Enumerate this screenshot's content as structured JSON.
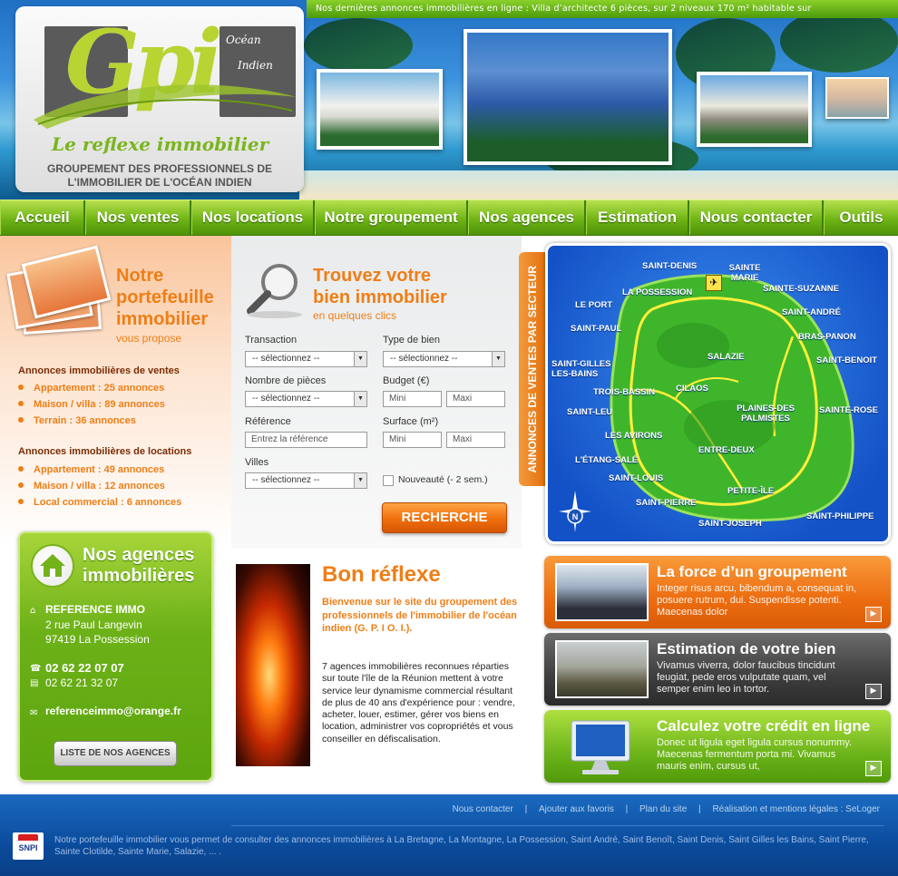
{
  "header": {
    "ticker": "Nos dernières annonces immobilières en ligne : Villa d’architecte 6 pièces, sur 2 niveaux 170 m² habitable sur",
    "logo_letters": "Gpi",
    "logo_ocean": "Océan",
    "logo_indien": "Indien",
    "logo_tagline": "Le reflexe immobilier",
    "logo_sub1": "GROUPEMENT DES PROFESSIONNELS DE",
    "logo_sub2": "L'IMMOBILIER DE L'OCÉAN INDIEN"
  },
  "nav": [
    {
      "label": "Accueil"
    },
    {
      "label": "Nos ventes"
    },
    {
      "label": "Nos locations"
    },
    {
      "label": "Notre groupement"
    },
    {
      "label": "Nos agences"
    },
    {
      "label": "Estimation"
    },
    {
      "label": "Nous contacter"
    },
    {
      "label": "Outils"
    }
  ],
  "portfolio": {
    "title": "Notre portefeuille immobilier",
    "subtitle": "vous propose",
    "sales_heading": "Annonces immobilières de ventes",
    "sales": [
      "Appartement : 25 annonces",
      "Maison / villa : 89 annonces",
      "Terrain : 36 annonces"
    ],
    "rentals_heading": "Annonces immobilières de locations",
    "rentals": [
      "Appartement : 49 annonces",
      "Maison / villa : 12 annonces",
      "Local commercial : 6 annonces"
    ]
  },
  "agencies": {
    "title": "Nos agences immobilières",
    "name": "REFERENCE IMMO",
    "address1": "2 rue Paul Langevin",
    "address2": "97419 La Possession",
    "phone": "02 62 22 07 07",
    "fax": "02 62 21 32 07",
    "email": "referenceimmo@orange.fr",
    "button": "LISTE DE NOS AGENCES"
  },
  "search": {
    "title": "Trouvez votre bien immobilier",
    "subtitle": "en quelques clics",
    "transaction_label": "Transaction",
    "type_label": "Type de bien",
    "rooms_label": "Nombre de pièces",
    "budget_label": "Budget (€)",
    "reference_label": "Référence",
    "surface_label": "Surface (m²)",
    "cities_label": "Villes",
    "select_placeholder": "-- sélectionnez --",
    "reference_placeholder": "Entrez la référence",
    "min_placeholder": "Mini",
    "max_placeholder": "Maxi",
    "new_label": "Nouveauté (- 2 sem.)",
    "button": "RECHERCHE"
  },
  "map": {
    "tab_label": "ANNONCES DE VENTES  PAR SECTEUR",
    "towns": [
      "SAINT-DENIS",
      "SAINTE MARIE",
      "SAINTE-SUZANNE",
      "LA POSSESSION",
      "LE PORT",
      "SAINT-ANDRÉ",
      "SAINT-PAUL",
      "BRAS-PANON",
      "SALAZIE",
      "SAINT-BENOIT",
      "SAINT-GILLES LES-BAINS",
      "TROIS-BASSIN",
      "CILAOS",
      "PLAINES-DES PALMISTES",
      "SAINT-LEU",
      "SAINTE-ROSE",
      "LES AVIRONS",
      "ENTRE-DEUX",
      "L'ÉTANG-SALÉ",
      "SAINT-LOUIS",
      "PETITE-ÎLE",
      "SAINT-PIERRE",
      "SAINT-JOSEPH",
      "SAINT-PHILIPPE"
    ],
    "compass": "N"
  },
  "bon_reflexe": {
    "title": "Bon réflexe",
    "intro": "Bienvenue sur le site du groupement des professionnels de l'immobilier de l'océan indien (G. P. I O. I.).",
    "body": "7 agences immobilières reconnues réparties sur toute l'île de la Réunion mettent à votre service leur dynamisme commercial résultant de plus de 40 ans d'expérience pour : vendre, acheter, louer, estimer, gérer vos biens en location, administrer vos copropriétés et vous conseiller en défiscalisation."
  },
  "promos": [
    {
      "title": "La force d’un groupement",
      "text": "Integer risus arcu, bibendum a, consequat in, posuere rutrum, dui. Suspendisse potenti. Maecenas dolor",
      "color": "#ef7415"
    },
    {
      "title": "Estimation de votre bien",
      "text": "Vivamus viverra, dolor faucibus tincidunt feugiat, pede eros vulputate quam, vel semper enim leo in tortor.",
      "color": "#4a4a4a"
    },
    {
      "title": "Calculez votre crédit en ligne",
      "text": "Donec ut ligula eget ligula cursus nonummy. Maecenas fermentum porta mi. Vivamus mauris enim, cursus ut,",
      "color": "#6cb41a"
    }
  ],
  "footer": {
    "links": [
      "Nous contacter",
      "Ajouter aux favoris",
      "Plan du site",
      "Réalisation et mentions légales : SeLoger"
    ],
    "separator": "|",
    "snpi": "SNPI",
    "text": "Notre portefeuille immobilier vous permet de consulter des annonces immobilières à  La Bretagne, La Montagne, La Possession, Saint André, Saint Benoît, Saint Denis, Saint Gilles les Bains, Saint Pierre, Sainte Clotilde, Sainte Marie, Salazie, ... ."
  },
  "colors": {
    "accent_orange": "#ef7e16",
    "accent_green": "#6fb414",
    "footer_blue": "#0b4c9d"
  }
}
